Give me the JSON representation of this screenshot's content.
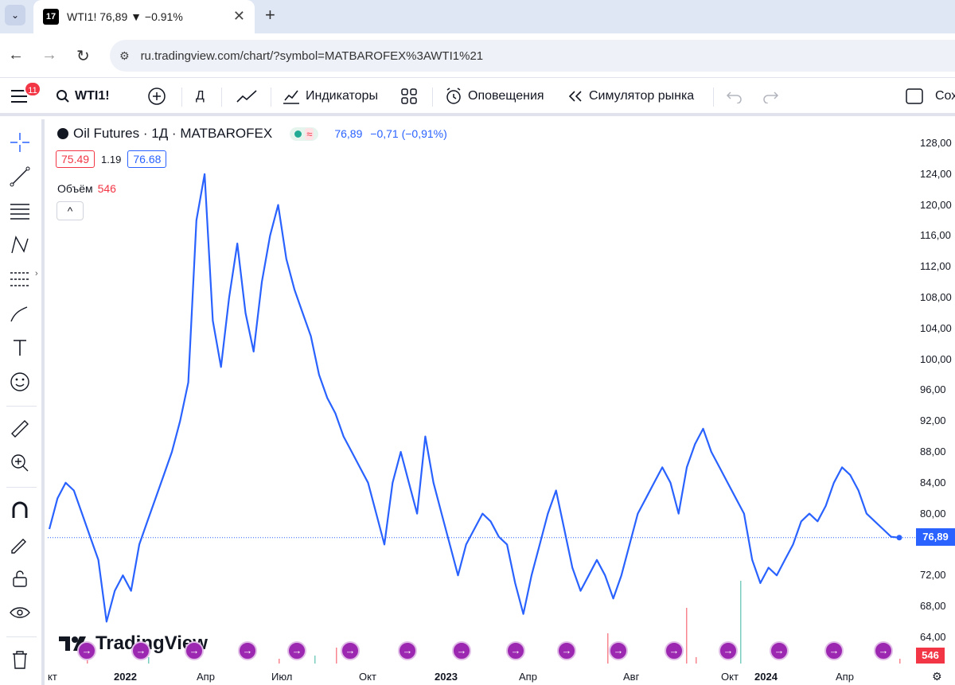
{
  "browser": {
    "tab_title": "WTI1! 76,89 ▼ −0.91%",
    "tab_icon": "17",
    "url": "ru.tradingview.com/chart/?symbol=MATBAROFEX%3AWTI1%21"
  },
  "toolbar": {
    "badge": "11",
    "symbol": "WTI1!",
    "interval": "Д",
    "indicators": "Индикаторы",
    "alerts": "Оповещения",
    "replay": "Симулятор рынка",
    "save_partial": "Сох"
  },
  "legend": {
    "title": "Oil Futures · 1Д · MATBAROFEX",
    "price": "76,89",
    "change": "−0,71 (−0,91%)",
    "low_box": "75.49",
    "spread": "1.19",
    "high_box": "76.68",
    "volume_label": "Объём",
    "volume_value": "546"
  },
  "logo": "TradingView",
  "price_axis": {
    "labels": [
      "128,00",
      "124,00",
      "120,00",
      "116,00",
      "112,00",
      "108,00",
      "104,00",
      "100,00",
      "96,00",
      "92,00",
      "88,00",
      "84,00",
      "80,00",
      "72,00",
      "68,00",
      "64,00"
    ],
    "last_price": "76,89",
    "last_volume": "546"
  },
  "time_axis": {
    "labels": [
      "кт",
      "2022",
      "Апр",
      "Июл",
      "Окт",
      "2023",
      "Апр",
      "Авг",
      "Окт",
      "2024",
      "Апр"
    ]
  },
  "colors": {
    "line": "#2962ff",
    "volume_down": "#f23645",
    "volume_up": "#22ab94",
    "event": "#9c27b0"
  },
  "chart_data": {
    "type": "line",
    "title": "Oil Futures · 1Д · MATBAROFEX",
    "ylim": [
      62,
      130
    ],
    "grid": false,
    "series": [
      {
        "values": [
          78,
          82,
          84,
          83,
          80,
          77,
          74,
          66,
          70,
          72,
          70,
          76,
          79,
          82,
          85,
          88,
          92,
          97,
          118,
          124,
          105,
          99,
          108,
          115,
          106,
          101,
          110,
          116,
          120,
          113,
          109,
          106,
          103,
          98,
          95,
          93,
          90,
          88,
          86,
          84,
          80,
          76,
          84,
          88,
          84,
          80,
          90,
          84,
          80,
          76,
          72,
          76,
          78,
          80,
          79,
          77,
          76,
          71,
          67,
          72,
          76,
          80,
          83,
          78,
          73,
          70,
          72,
          74,
          72,
          69,
          72,
          76,
          80,
          82,
          84,
          86,
          84,
          80,
          86,
          89,
          91,
          88,
          86,
          84,
          82,
          80,
          74,
          71,
          73,
          72,
          74,
          76,
          79,
          80,
          79,
          81,
          84,
          86,
          85,
          83,
          80,
          79,
          78,
          77,
          76.89
        ]
      }
    ],
    "x_labels": [
      "кт",
      "2022",
      "Апр",
      "Июл",
      "Окт",
      "2023",
      "Апр",
      "Авг",
      "Окт",
      "2024",
      "Апр"
    ],
    "volume_last": 546
  }
}
